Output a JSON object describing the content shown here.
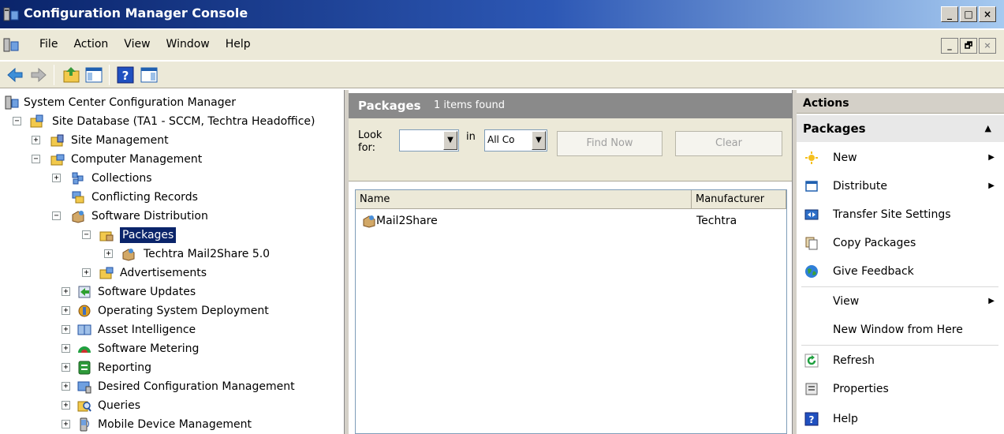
{
  "window": {
    "title": "Configuration Manager Console",
    "controls": [
      "_",
      "□",
      "×"
    ]
  },
  "menu": {
    "items": [
      "File",
      "Action",
      "View",
      "Window",
      "Help"
    ],
    "mdi_controls": [
      "_",
      "🗗",
      "×"
    ]
  },
  "toolbar": {
    "buttons": [
      "back-icon",
      "forward-icon",
      "up-folder-icon",
      "show-hide-tree-icon",
      "help-icon",
      "show-hide-action-pane-icon"
    ]
  },
  "tree": {
    "root": "System Center Configuration Manager",
    "site_database": "Site Database  (TA1 - SCCM, Techtra Headoffice)",
    "site_management": "Site Management",
    "computer_management": "Computer Management",
    "collections": "Collections",
    "conflicting_records": "Conflicting Records",
    "software_distribution": "Software Distribution",
    "packages": "Packages",
    "package_item": "Techtra Mail2Share 5.0",
    "advertisements": "Advertisements",
    "software_updates": "Software Updates",
    "os_deployment": "Operating System Deployment",
    "asset_intelligence": "Asset Intelligence",
    "software_metering": "Software Metering",
    "reporting": "Reporting",
    "dcm": "Desired Configuration Management",
    "queries": "Queries",
    "mobile_device": "Mobile Device Management",
    "expander_plus": "+",
    "expander_minus": "−"
  },
  "results": {
    "title": "Packages",
    "count_text": "1 items found",
    "look_for_label": "Look for:",
    "look_for_value": "",
    "in_label": "in",
    "in_value": "All Co",
    "find_now": "Find Now",
    "clear": "Clear",
    "columns": [
      "Name",
      "Manufacturer"
    ],
    "rows": [
      {
        "name": "Mail2Share",
        "manufacturer": "Techtra"
      }
    ]
  },
  "actions": {
    "header": "Actions",
    "section": "Packages",
    "items": [
      {
        "label": "New",
        "icon": "new-icon",
        "submenu": true
      },
      {
        "label": "Distribute",
        "icon": "distribute-icon",
        "submenu": true
      },
      {
        "label": "Transfer Site Settings",
        "icon": "transfer-icon",
        "submenu": false
      },
      {
        "label": "Copy Packages",
        "icon": "copy-icon",
        "submenu": false
      },
      {
        "label": "Give Feedback",
        "icon": "globe-icon",
        "submenu": false
      },
      {
        "label": "View",
        "icon": "",
        "submenu": true
      },
      {
        "label": "New Window from Here",
        "icon": "",
        "submenu": false
      },
      {
        "label": "Refresh",
        "icon": "refresh-icon",
        "submenu": false
      },
      {
        "label": "Properties",
        "icon": "properties-icon",
        "submenu": false
      },
      {
        "label": "Help",
        "icon": "help-icon",
        "submenu": false
      }
    ]
  },
  "colors": {
    "titlebar_start": "#0a246a",
    "titlebar_end": "#a6caf0",
    "selection": "#0a246a",
    "panel_header": "#8a8a8a"
  }
}
